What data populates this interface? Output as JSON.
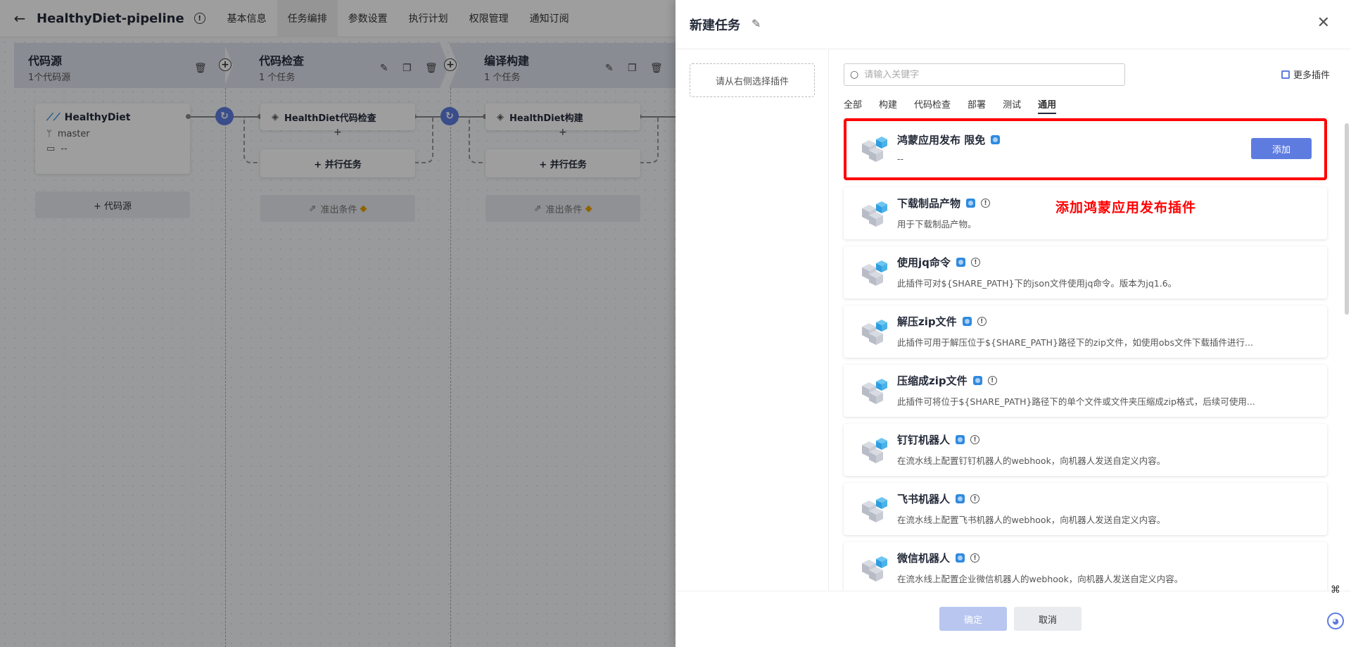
{
  "header": {
    "back_icon": "arrow-left-icon",
    "title": "HealthyDiet-pipeline",
    "tabs": [
      "基本信息",
      "任务编排",
      "参数设置",
      "执行计划",
      "权限管理",
      "通知订阅"
    ],
    "active_tab": "任务编排"
  },
  "stages": [
    {
      "name": "代码源",
      "sub": "1个代码源"
    },
    {
      "name": "代码检查",
      "sub": "1 个任务"
    },
    {
      "name": "编译构建",
      "sub": "1 个任务"
    }
  ],
  "source_card": {
    "name": "HealthyDiet",
    "branch": "master",
    "extra": "--"
  },
  "add_source_label": "+ 代码源",
  "tasks": [
    {
      "name": "HealthDiet代码检查"
    },
    {
      "name": "HealthDiet构建"
    }
  ],
  "parallel_label": "+ 并行任务",
  "exit_label": "准出条件",
  "drawer": {
    "title": "新建任务",
    "pick_hint": "请从右侧选择插件",
    "search_placeholder": "请输入关键字",
    "more_plugins": "更多插件",
    "filter_tabs": [
      "全部",
      "构建",
      "代码检查",
      "部署",
      "测试",
      "通用"
    ],
    "active_filter": "通用",
    "add_label": "添加",
    "plugins": [
      {
        "name": "鸿蒙应用发布 限免",
        "desc": "--",
        "highlight": true
      },
      {
        "name": "下载制品产物",
        "desc": "用于下载制品产物。"
      },
      {
        "name": "使用jq命令",
        "desc": "此插件可对${SHARE_PATH}下的json文件使用jq命令。版本为jq1.6。"
      },
      {
        "name": "解压zip文件",
        "desc": "此插件可用于解压位于${SHARE_PATH}路径下的zip文件，如使用obs文件下载插件进行..."
      },
      {
        "name": "压缩成zip文件",
        "desc": "此插件可将位于${SHARE_PATH}路径下的单个文件或文件夹压缩成zip格式，后续可使用..."
      },
      {
        "name": "钉钉机器人",
        "desc": "在流水线上配置钉钉机器人的webhook，向机器人发送自定义内容。"
      },
      {
        "name": "飞书机器人",
        "desc": "在流水线上配置飞书机器人的webhook，向机器人发送自定义内容。"
      },
      {
        "name": "微信机器人",
        "desc": "在流水线上配置企业微信机器人的webhook，向机器人发送自定义内容。"
      }
    ],
    "annotation": "添加鸿蒙应用发布插件",
    "ok_label": "确定",
    "cancel_label": "取消"
  },
  "colors": {
    "primary": "#5e7ce0",
    "highlight_border": "#ff0000",
    "annotation": "#ff0000"
  }
}
